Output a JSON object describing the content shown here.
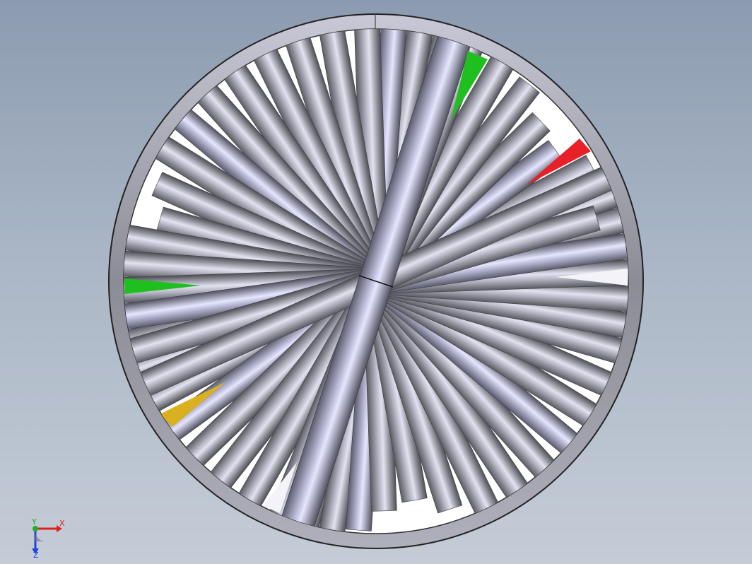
{
  "viewport": {
    "background_top": "#8c9bb0",
    "background_bottom": "#c4ccd6"
  },
  "model": {
    "frame_ring_color": "#9a9aa6",
    "rod_color": "#8e8e98",
    "highlight_color": "#e2e2f0",
    "tip_colors": {
      "green": "#1fbf1f",
      "red": "#e8202a",
      "white": "#f4f4f8",
      "yellow": "#d8b020"
    }
  },
  "triad": {
    "x_label": "X",
    "y_label": "Y",
    "z_label": "Z",
    "x_color": "#e02020",
    "y_color": "#20b020",
    "z_color": "#2040e0"
  }
}
